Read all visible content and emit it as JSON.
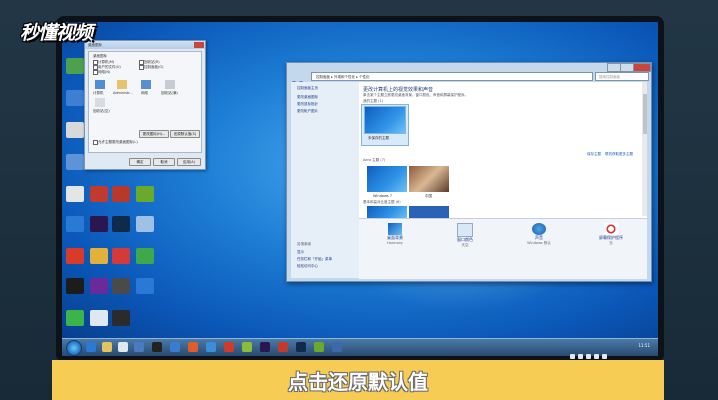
{
  "watermark": {
    "text": "秒懂视频"
  },
  "caption": {
    "text": "点击还原默认值"
  },
  "dialog": {
    "title": "桌面图标",
    "group_label": "桌面图标",
    "checkboxes": [
      "计算机(M)",
      "回收站(R)",
      "用户的文件(U)",
      "控制面板(O)",
      "网络(N)"
    ],
    "icons": [
      "计算机",
      "Administr...",
      "网络",
      "回收站(满)",
      "回收站(空)"
    ],
    "change_icon_button": "更改图标(H)...",
    "restore_default_button": "还原默认值(S)",
    "allow_themes_label": "允许主题更改桌面图标(L)",
    "ok_button": "确定",
    "cancel_button": "取消",
    "apply_button": "应用(A)"
  },
  "window": {
    "address_path": "控制面板 ▸ 外观和个性化 ▸ 个性化",
    "search_placeholder": "搜索控制面板",
    "left_links": [
      "控制面板主页",
      "更改桌面图标",
      "更改鼠标指针",
      "更改帐户图片"
    ],
    "see_also_label": "另请参阅",
    "see_also_links": [
      "显示",
      "任务栏和「开始」菜单",
      "轻松访问中心"
    ],
    "heading": "更改计算机上的视觉效果和声音",
    "subheading": "单击某个主题立即更改桌面背景、窗口颜色、声音和屏幕保护程序。",
    "my_themes_label": "我的主题 (1)",
    "unsaved_theme_label": "未保存的主题",
    "save_theme_link": "保存主题",
    "online_themes_link": "联机获取更多主题",
    "aero_themes_label": "Aero 主题 (7)",
    "aero_themes": [
      "Windows 7",
      "中国"
    ],
    "basic_themes_label": "基本和高对比度主题 (6)",
    "bottom_items": [
      {
        "caption": "桌面背景",
        "value": "Harmony"
      },
      {
        "caption": "窗口颜色",
        "value": "天空"
      },
      {
        "caption": "声音",
        "value": "Windows 默认"
      },
      {
        "caption": "屏幕保护程序",
        "value": "无"
      }
    ]
  },
  "taskbar": {
    "clock": "11:51"
  },
  "colors": {
    "caption_bg": "#f6cc54",
    "desktop": "#1e7fd6",
    "window_frame": "#c4d8ec"
  }
}
